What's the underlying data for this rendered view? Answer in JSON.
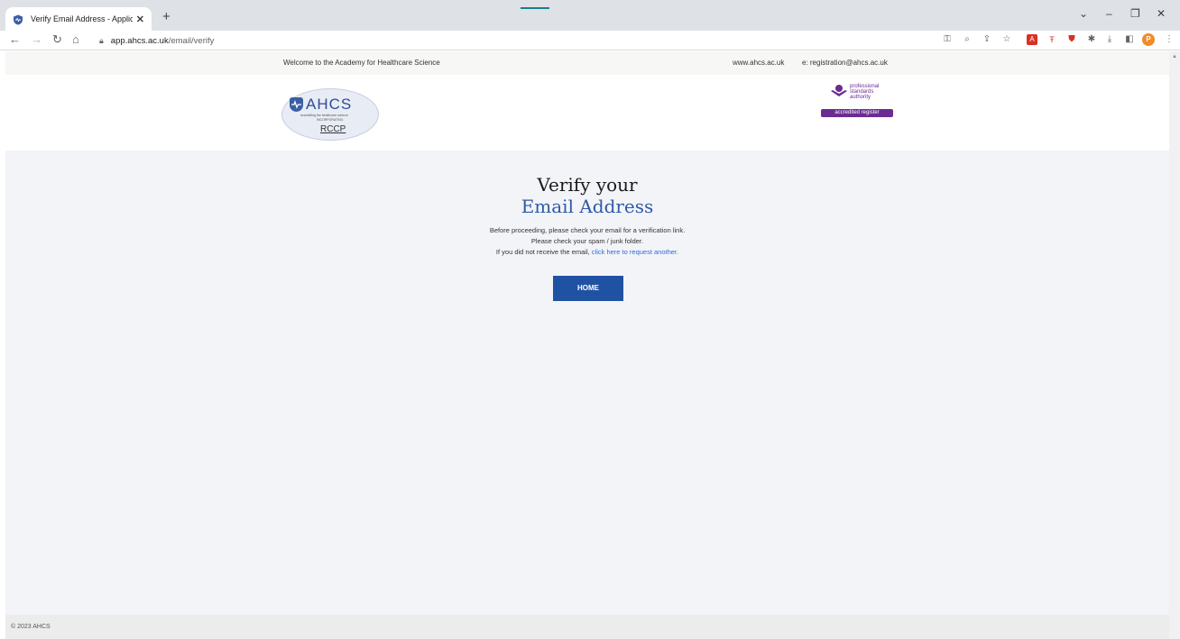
{
  "browser": {
    "tab_title": "Verify Email Address - Applicant I",
    "tab_close": "✕",
    "new_tab": "+",
    "url_host": "app.ahcs.ac.uk",
    "url_path": "/email/verify",
    "profile_initial": "P",
    "window_controls": [
      "⌄",
      "–",
      "❐",
      "✕"
    ]
  },
  "welcome_bar": {
    "text": "Welcome to the Academy for Healthcare Science",
    "website": "www.ahcs.ac.uk",
    "email": "e: registration@ahcs.ac.uk"
  },
  "logos": {
    "ahcs_wordmark": "AHCS",
    "ahcs_tagline": "accrediting the healthcare science",
    "ahcs_incorporating": "INCORPORATING",
    "rccp": "RCCP",
    "psa_line1": "professional",
    "psa_line2": "standards",
    "psa_line3": "authority",
    "psa_badge": "accredited register"
  },
  "main": {
    "heading_line1": "Verify your",
    "heading_line2": "Email Address",
    "message_1": "Before proceeding, please check your email for a verification link.",
    "message_2": "Please check your spam / junk folder.",
    "message_3_prefix": "If you did not receive the email,",
    "resend_link": "click here to request another.",
    "home_button": "HOME"
  },
  "footer": {
    "copyright": "© 2023 AHCS"
  },
  "colors": {
    "brand_blue": "#2052a4",
    "heading_blue": "#2e5aa6",
    "link_blue": "#2f6bd6",
    "psa_purple": "#6b2c91"
  }
}
